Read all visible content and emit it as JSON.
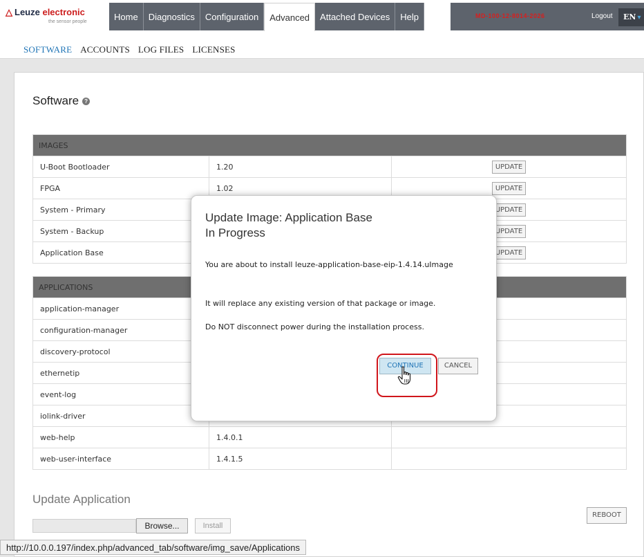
{
  "header": {
    "brand_prefix": "Leuze ",
    "brand_suffix": "electronic",
    "tagline": "the sensor people",
    "tabs": [
      "Home",
      "Diagnostics",
      "Configuration",
      "Advanced",
      "Attached Devices",
      "Help"
    ],
    "active_tab": "Advanced",
    "device_name": "MD-100-12-8014-2026",
    "logout_label": "Logout",
    "language": "EN"
  },
  "subnav": {
    "items": [
      "SOFTWARE",
      "ACCOUNTS",
      "LOG FILES",
      "LICENSES"
    ],
    "active": "SOFTWARE"
  },
  "software": {
    "title": "Software",
    "images_header": "IMAGES",
    "images": [
      {
        "name": "U-Boot Bootloader",
        "version": "1.20",
        "action": "UPDATE"
      },
      {
        "name": "FPGA",
        "version": "1.02",
        "action": "UPDATE"
      },
      {
        "name": "System - Primary",
        "version": "",
        "action": "UPDATE"
      },
      {
        "name": "System - Backup",
        "version": "",
        "action": "UPDATE"
      },
      {
        "name": "Application Base",
        "version": "",
        "action": "UPDATE"
      }
    ],
    "applications_header": "APPLICATIONS",
    "applications": [
      {
        "name": "application-manager",
        "version": ""
      },
      {
        "name": "configuration-manager",
        "version": ""
      },
      {
        "name": "discovery-protocol",
        "version": ""
      },
      {
        "name": "ethernetip",
        "version": ""
      },
      {
        "name": "event-log",
        "version": ""
      },
      {
        "name": "iolink-driver",
        "version": ""
      },
      {
        "name": "web-help",
        "version": "1.4.0.1"
      },
      {
        "name": "web-user-interface",
        "version": "1.4.1.5"
      }
    ]
  },
  "update_application": {
    "title": "Update Application",
    "browse_label": "Browse...",
    "install_label": "Install",
    "reboot_label": "REBOOT"
  },
  "modal": {
    "title_line1": "Update Image: Application Base",
    "title_line2": "In Progress",
    "message1": "You are about to install leuze-application-base-eip-1.4.14.uImage",
    "message2": "It will replace any existing version of that package or image.",
    "message3": "Do NOT disconnect power during the installation process.",
    "continue_label": "CONTINUE",
    "cancel_label": "CANCEL"
  },
  "status_url": "http://10.0.0.197/index.php/advanced_tab/software/img_save/Applications",
  "colors": {
    "nav_bg": "#5d636c",
    "accent_blue": "#1f74b6",
    "brand_red": "#cc1d1d",
    "table_header": "#6f6f6f",
    "highlight_red": "#d0151b"
  }
}
